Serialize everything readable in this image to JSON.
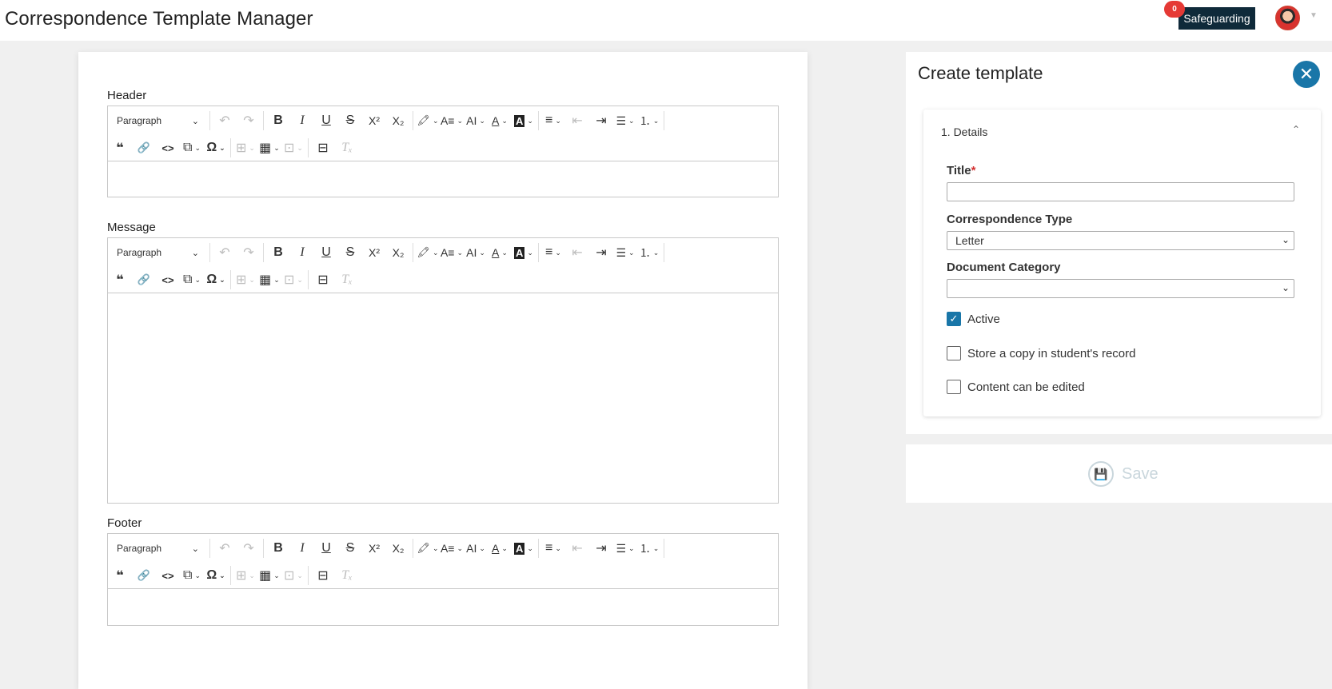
{
  "app": {
    "title": "Correspondence Template Manager"
  },
  "topbar": {
    "safeguarding_label": "Safeguarding",
    "notification_count": "0"
  },
  "toolbar": {
    "paragraph": "Paragraph",
    "icons": {
      "undo": "↶",
      "redo": "↷",
      "bold": "B",
      "italic": "I",
      "underline": "U",
      "strike": "S",
      "superscript": "X²",
      "subscript": "X₂",
      "highlight": "🖍",
      "font_size": "A≡",
      "line_height": "AI",
      "font_color": "A",
      "bg_color": "A",
      "align": "≡",
      "outdent": "⇤",
      "indent": "⇥",
      "bullets": "☰",
      "numbers": "⒈",
      "quote": "❝",
      "link": "🔗",
      "code": "<>",
      "source": "⧉",
      "special_char": "Ω",
      "table_cell": "⊞",
      "table": "▦",
      "table_merge": "⊡",
      "page_break": "⊟",
      "clear_format": "Tₓ",
      "caret": "⌄"
    }
  },
  "editors": {
    "header_label": "Header",
    "message_label": "Message",
    "footer_label": "Footer"
  },
  "panel": {
    "title": "Create template",
    "close_icon": "✕",
    "section": "1. Details",
    "collapse_icon": "⌃",
    "title_label": "Title",
    "required_mark": "*",
    "title_value": "",
    "type_label": "Correspondence Type",
    "type_value": "Letter",
    "category_label": "Document Category",
    "category_value": "",
    "select_arrow": "⌄",
    "checkboxes": {
      "active": {
        "label": "Active",
        "checked": true
      },
      "store_copy": {
        "label": "Store a copy in student's record",
        "checked": false
      },
      "editable": {
        "label": "Content can be edited",
        "checked": false
      }
    },
    "check_mark": "✓"
  },
  "save": {
    "label": "Save",
    "icon": "💾"
  },
  "colors": {
    "accent": "#1976a8",
    "navy": "#0f2a3a",
    "badge": "#e53935",
    "required": "#d32f2f"
  }
}
